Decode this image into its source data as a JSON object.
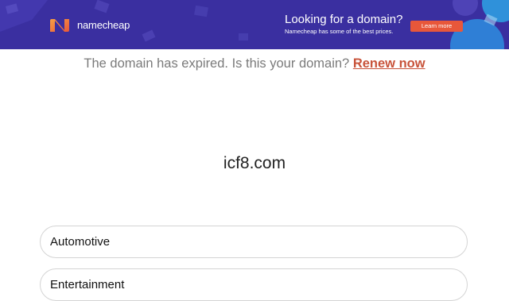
{
  "banner": {
    "brand": "namecheap",
    "headline": "Looking for a domain?",
    "subtext": "Namecheap has some of the best prices.",
    "cta_label": "Learn more",
    "logo_icon": "namecheap-n-logo",
    "colors": {
      "background": "#3a2fa0",
      "cta": "#e8573a",
      "logo_gradient_start": "#f7a043",
      "logo_gradient_end": "#e8573a"
    }
  },
  "notice": {
    "text": "The domain has expired. Is this your domain?",
    "link_label": "Renew now",
    "colors": {
      "text": "#7a7a7a",
      "link": "#c8533a"
    }
  },
  "domain": "icf8.com",
  "categories": [
    {
      "label": "Automotive"
    },
    {
      "label": "Entertainment"
    }
  ]
}
